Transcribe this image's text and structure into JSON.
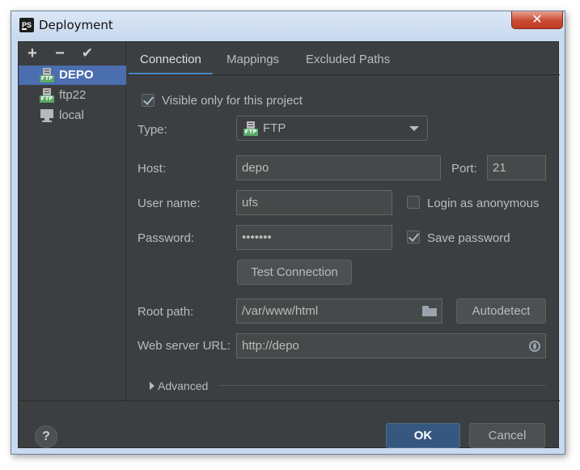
{
  "window": {
    "title": "Deployment",
    "close_glyph": "✕"
  },
  "left_toolbar": {
    "add": "+",
    "remove": "−",
    "check": "✔"
  },
  "servers": [
    {
      "label": "DEPO",
      "icon": "ftp-icon",
      "selected": true,
      "ftp_tag": "FTP"
    },
    {
      "label": "ftp22",
      "icon": "ftp-icon",
      "selected": false,
      "ftp_tag": "FTP"
    },
    {
      "label": "local",
      "icon": "local-folder-icon",
      "selected": false
    }
  ],
  "tabs": [
    {
      "label": "Connection",
      "active": true
    },
    {
      "label": "Mappings",
      "active": false
    },
    {
      "label": "Excluded Paths",
      "active": false
    }
  ],
  "connection": {
    "visible_only_label": "Visible only for this project",
    "visible_only_checked": true,
    "type_label": "Type:",
    "type_value": "FTP",
    "type_tag": "FTP",
    "host_label": "Host:",
    "host_value": "depo",
    "port_label": "Port:",
    "port_value": "21",
    "username_label": "User name:",
    "username_value": "ufs",
    "anonymous_label": "Login as anonymous",
    "anonymous_checked": false,
    "password_label": "Password:",
    "password_value": "•••••••",
    "save_password_label": "Save password",
    "save_password_checked": true,
    "test_button": "Test Connection",
    "root_label": "Root path:",
    "root_value": "/var/www/html",
    "autodetect_button": "Autodetect",
    "web_url_label": "Web server URL:",
    "web_url_value": "http://depo",
    "advanced_label": "Advanced"
  },
  "footer": {
    "help": "?",
    "ok": "OK",
    "cancel": "Cancel"
  },
  "colors": {
    "background": "#3c3f41",
    "selection": "#4b6eaf",
    "tab_underline": "#4a88c7",
    "primary_button": "#365880",
    "ftp_badge": "#59a869"
  }
}
